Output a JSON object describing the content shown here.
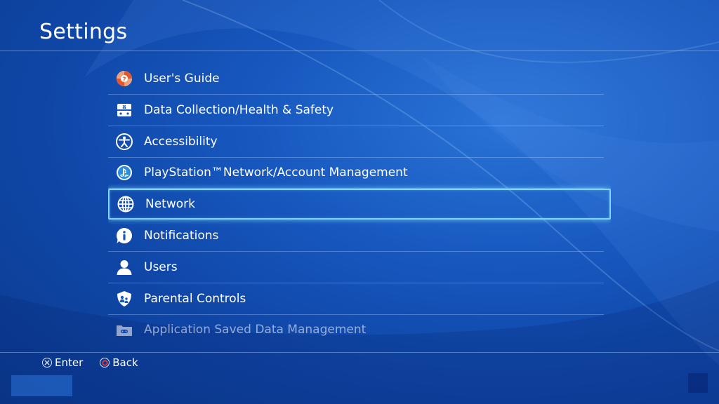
{
  "header": {
    "title": "Settings"
  },
  "menu": {
    "items": [
      {
        "label": "User's Guide",
        "icon": "lifebuoy-icon"
      },
      {
        "label": "Data Collection/Health & Safety",
        "icon": "health-safety-icon"
      },
      {
        "label": "Accessibility",
        "icon": "accessibility-icon"
      },
      {
        "label": "PlayStation™Network/Account Management",
        "icon": "playstation-icon"
      },
      {
        "label": "Network",
        "icon": "globe-icon",
        "selected": true
      },
      {
        "label": "Notifications",
        "icon": "info-bubble-icon"
      },
      {
        "label": "Users",
        "icon": "user-icon"
      },
      {
        "label": "Parental Controls",
        "icon": "parental-shield-icon"
      },
      {
        "label": "Application Saved Data Management",
        "icon": "saved-data-folder-icon"
      }
    ]
  },
  "footer": {
    "enter_label": "Enter",
    "back_label": "Back",
    "enter_icon": "cross-button-icon",
    "back_icon": "circle-button-icon"
  },
  "colors": {
    "selection_outline": "#7fd3ff",
    "background": "#1758bf",
    "circle_button": "#e8413a"
  }
}
